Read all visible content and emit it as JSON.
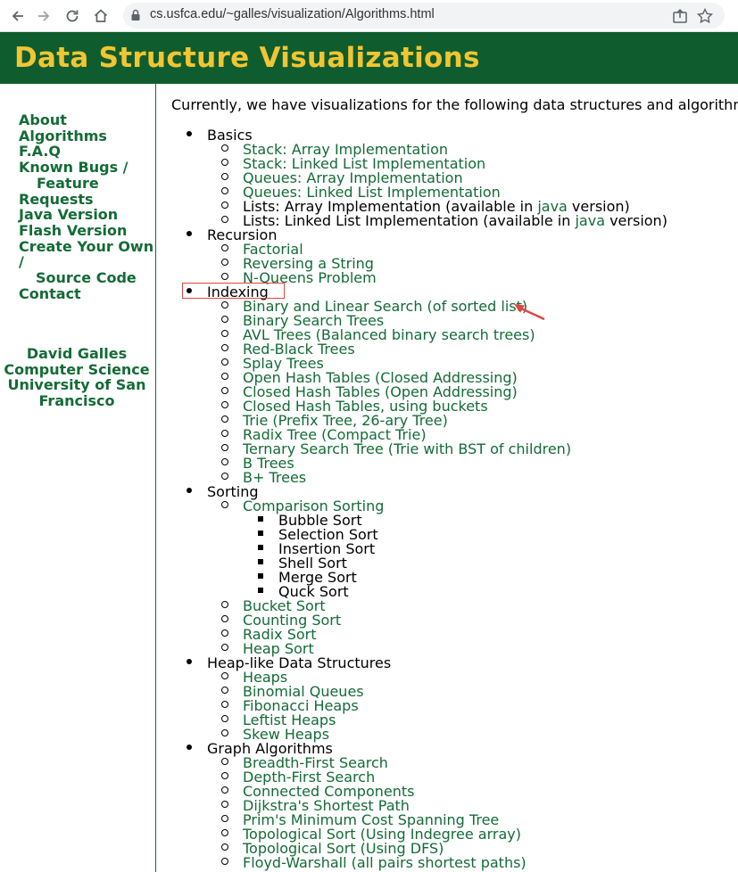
{
  "browser": {
    "url": "cs.usfca.edu/~galles/visualization/Algorithms.html"
  },
  "header": {
    "title": "Data Structure Visualizations"
  },
  "sidebar": {
    "nav": [
      {
        "lines": [
          "About"
        ]
      },
      {
        "lines": [
          "Algorithms"
        ]
      },
      {
        "lines": [
          "F.A.Q"
        ]
      },
      {
        "lines": [
          "Known Bugs /",
          "Feature",
          "Requests"
        ]
      },
      {
        "lines": [
          "Java Version"
        ]
      },
      {
        "lines": [
          "Flash Version"
        ]
      },
      {
        "lines": [
          "Create Your Own",
          "/",
          "Source Code"
        ]
      },
      {
        "lines": [
          "Contact"
        ]
      }
    ],
    "author": [
      "David Galles",
      "Computer Science",
      "University of San",
      "Francisco"
    ]
  },
  "main": {
    "intro": "Currently, we have visualizations for the following data structures and algorithms:",
    "items": [
      {
        "level": 1,
        "text": "Basics",
        "link": false
      },
      {
        "level": 2,
        "text": "Stack: Array Implementation",
        "link": true
      },
      {
        "level": 2,
        "text": "Stack: Linked List Implementation",
        "link": true
      },
      {
        "level": 2,
        "text": "Queues: Array Implementation",
        "link": true
      },
      {
        "level": 2,
        "text": "Queues: Linked List Implementation",
        "link": true
      },
      {
        "level": 2,
        "parts": [
          {
            "t": "Lists: Array Implementation (available in ",
            "link": false
          },
          {
            "t": "java",
            "link": true
          },
          {
            "t": " version)",
            "link": false
          }
        ]
      },
      {
        "level": 2,
        "parts": [
          {
            "t": "Lists: Linked List Implementation (available in ",
            "link": false
          },
          {
            "t": "java",
            "link": true
          },
          {
            "t": " version)",
            "link": false
          }
        ]
      },
      {
        "level": 1,
        "text": "Recursion",
        "link": false
      },
      {
        "level": 2,
        "text": "Factorial",
        "link": true
      },
      {
        "level": 2,
        "text": "Reversing a String",
        "link": true
      },
      {
        "level": 2,
        "text": "N-Queens Problem",
        "link": true
      },
      {
        "level": 1,
        "text": "Indexing",
        "link": false
      },
      {
        "level": 2,
        "text": "Binary and Linear Search (of sorted list)",
        "link": true
      },
      {
        "level": 2,
        "text": "Binary Search Trees",
        "link": true
      },
      {
        "level": 2,
        "text": "AVL Trees (Balanced binary search trees)",
        "link": true
      },
      {
        "level": 2,
        "text": "Red-Black Trees",
        "link": true
      },
      {
        "level": 2,
        "text": "Splay Trees",
        "link": true
      },
      {
        "level": 2,
        "text": "Open Hash Tables (Closed Addressing)",
        "link": true
      },
      {
        "level": 2,
        "text": "Closed Hash Tables (Open Addressing)",
        "link": true
      },
      {
        "level": 2,
        "text": "Closed Hash Tables, using buckets",
        "link": true
      },
      {
        "level": 2,
        "text": "Trie (Prefix Tree, 26-ary Tree)",
        "link": true
      },
      {
        "level": 2,
        "text": "Radix Tree (Compact Trie)",
        "link": true
      },
      {
        "level": 2,
        "text": "Ternary Search Tree (Trie with BST of children)",
        "link": true
      },
      {
        "level": 2,
        "text": "B Trees",
        "link": true
      },
      {
        "level": 2,
        "text": "B+ Trees",
        "link": true
      },
      {
        "level": 1,
        "text": "Sorting",
        "link": false
      },
      {
        "level": 2,
        "text": "Comparison Sorting",
        "link": true
      },
      {
        "level": 3,
        "text": "Bubble Sort",
        "link": false
      },
      {
        "level": 3,
        "text": "Selection Sort",
        "link": false
      },
      {
        "level": 3,
        "text": "Insertion Sort",
        "link": false
      },
      {
        "level": 3,
        "text": "Shell Sort",
        "link": false
      },
      {
        "level": 3,
        "text": "Merge Sort",
        "link": false
      },
      {
        "level": 3,
        "text": "Quck Sort",
        "link": false
      },
      {
        "level": 2,
        "text": "Bucket Sort",
        "link": true
      },
      {
        "level": 2,
        "text": "Counting Sort",
        "link": true
      },
      {
        "level": 2,
        "text": "Radix Sort",
        "link": true
      },
      {
        "level": 2,
        "text": "Heap Sort",
        "link": true
      },
      {
        "level": 1,
        "text": "Heap-like Data Structures",
        "link": false
      },
      {
        "level": 2,
        "text": "Heaps",
        "link": true
      },
      {
        "level": 2,
        "text": "Binomial Queues",
        "link": true
      },
      {
        "level": 2,
        "text": "Fibonacci Heaps",
        "link": true
      },
      {
        "level": 2,
        "text": "Leftist Heaps",
        "link": true
      },
      {
        "level": 2,
        "text": "Skew Heaps",
        "link": true
      },
      {
        "level": 1,
        "text": "Graph Algorithms",
        "link": false
      },
      {
        "level": 2,
        "text": "Breadth-First Search",
        "link": true
      },
      {
        "level": 2,
        "text": "Depth-First Search",
        "link": true
      },
      {
        "level": 2,
        "text": "Connected Components",
        "link": true
      },
      {
        "level": 2,
        "text": "Dijkstra's Shortest Path",
        "link": true
      },
      {
        "level": 2,
        "text": "Prim's Minimum Cost Spanning Tree",
        "link": true
      },
      {
        "level": 2,
        "text": "Topological Sort (Using Indegree array)",
        "link": true
      },
      {
        "level": 2,
        "text": "Topological Sort (Using DFS)",
        "link": true
      },
      {
        "level": 2,
        "text": "Floyd-Warshall (all pairs shortest paths)",
        "link": true
      }
    ]
  },
  "annotations": {
    "highlight_color": "#e3453f"
  },
  "colors": {
    "brand_green": "#0f5d2e",
    "title_gold": "#f2c532",
    "link_green": "#146b36"
  }
}
